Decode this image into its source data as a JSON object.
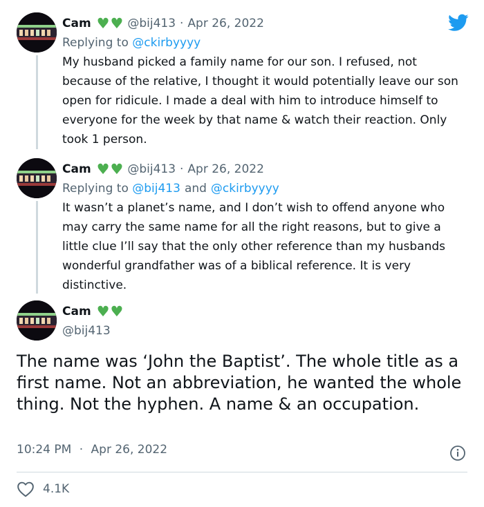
{
  "tweets": [
    {
      "name": "Cam",
      "handle": "@bij413",
      "separator": "·",
      "date": "Apr 26, 2022",
      "replying_prefix": "Replying to",
      "replying_to": [
        "@ckirbyyyy"
      ],
      "text": "My husband picked a family name for our son. I refused, not because of the relative, I thought it would potentially leave our son open for ridicule. I made a deal with him to introduce himself to everyone for the week by that name & watch their reaction. Only took 1 person."
    },
    {
      "name": "Cam",
      "handle": "@bij413",
      "separator": "·",
      "date": "Apr 26, 2022",
      "replying_prefix": "Replying to",
      "replying_to": [
        "@bij413",
        "@ckirbyyyy"
      ],
      "replying_joiner": "and",
      "text": "It wasn’t a planet’s name, and I don’t wish to offend anyone who may carry the same name for all the right reasons, but to give a little clue I’ll say that the only other reference than my husbands wonderful grandfather was of a biblical reference. It is very distinctive."
    }
  ],
  "main_tweet": {
    "name": "Cam",
    "handle": "@bij413",
    "text": "The name was ‘John the Baptist’. The whole title as a first name. Not an abbreviation, he wanted the whole thing. Not the hyphen. A name & an occupation.",
    "time": "10:24 PM",
    "separator": "·",
    "date": "Apr 26, 2022",
    "likes": "4.1K"
  },
  "icons": {
    "logo": "twitter-bird-icon",
    "heart": "green-heart-icon",
    "info": "info-icon",
    "like": "heart-outline-icon"
  },
  "colors": {
    "accent": "#1d9bf0",
    "heart_green": "#4caf50",
    "secondary_text": "#536471",
    "thread_line": "#cfd9de"
  }
}
